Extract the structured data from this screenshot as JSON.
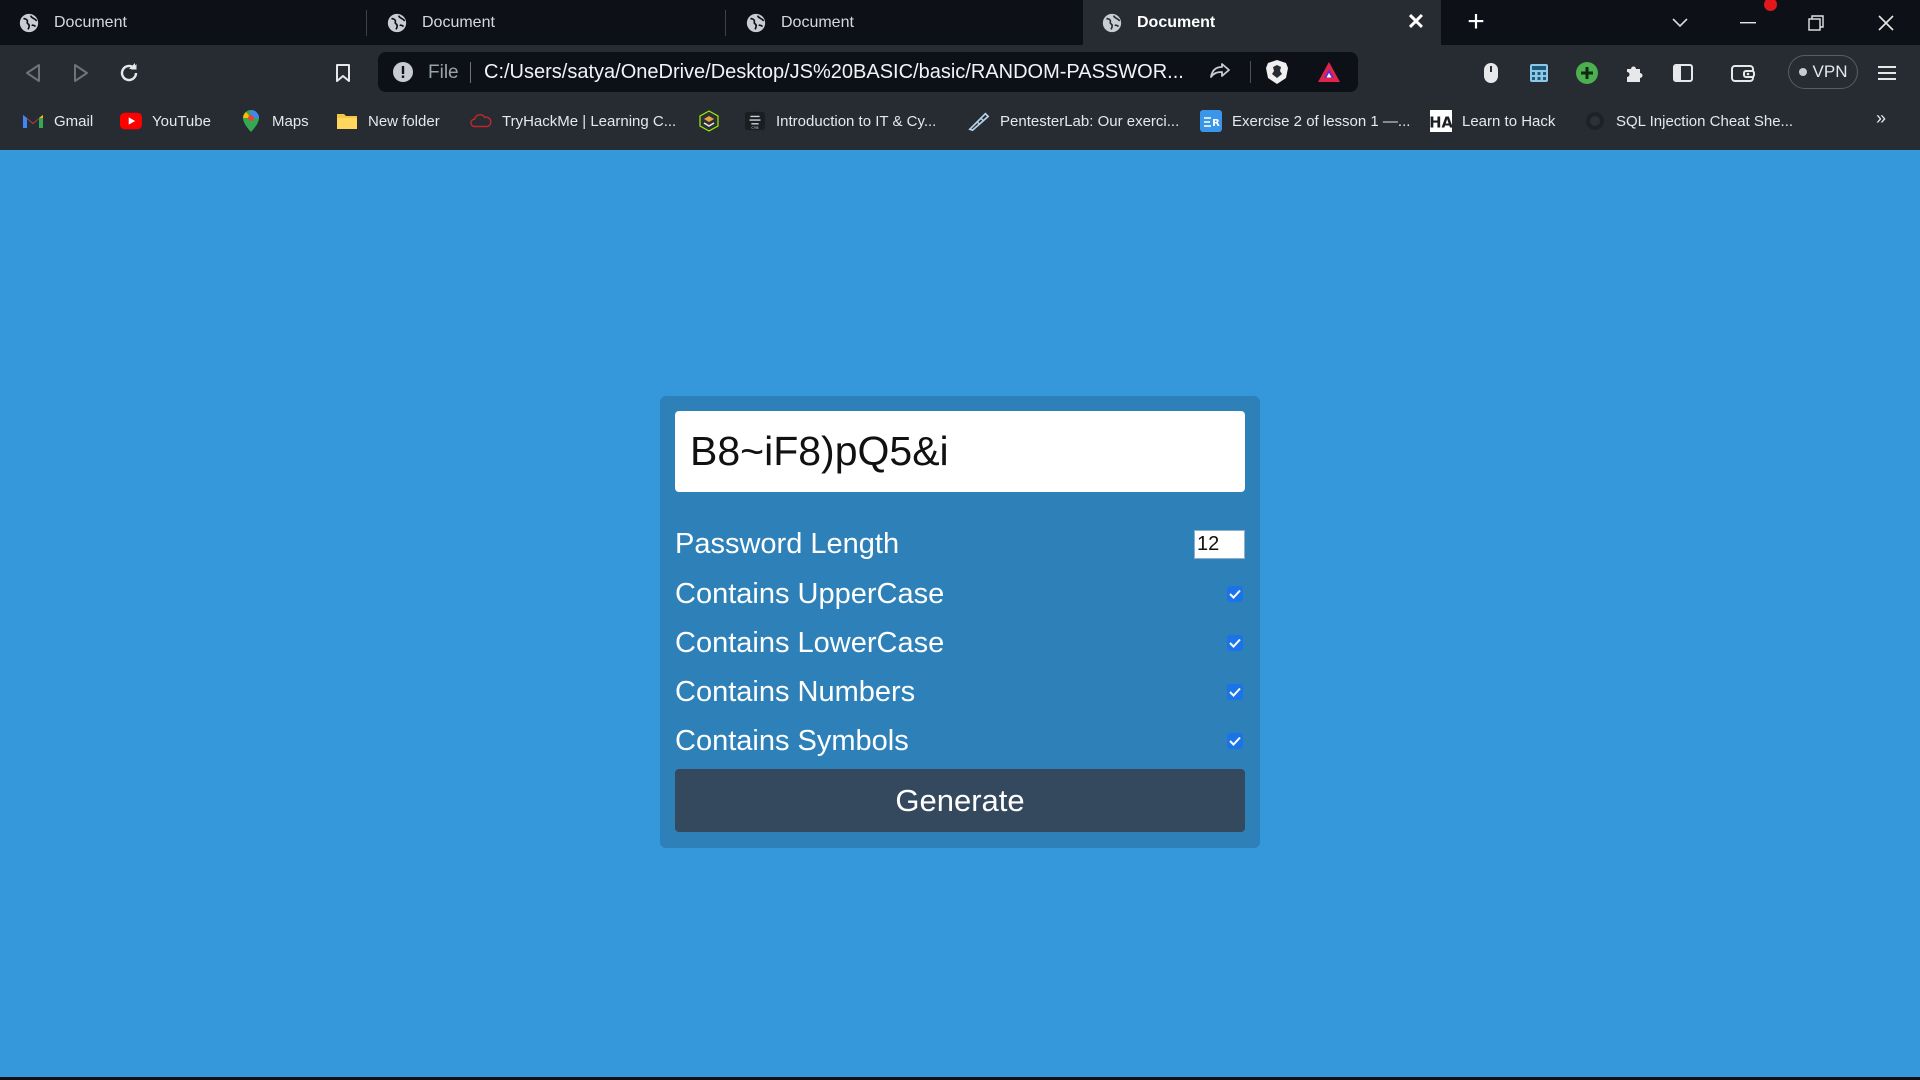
{
  "browser": {
    "tabs": [
      {
        "title": "Document",
        "active": false
      },
      {
        "title": "Document",
        "active": false
      },
      {
        "title": "Document",
        "active": false
      },
      {
        "title": "Document",
        "active": true
      }
    ],
    "address_bar": {
      "scheme_label": "File",
      "url": "C:/Users/satya/OneDrive/Desktop/JS%20BASIC/basic/RANDOM-PASSWOR..."
    },
    "vpn_label": "VPN",
    "bookmarks": [
      {
        "label": "Gmail",
        "icon": "gmail-icon"
      },
      {
        "label": "YouTube",
        "icon": "youtube-icon"
      },
      {
        "label": "Maps",
        "icon": "maps-icon"
      },
      {
        "label": "New folder",
        "icon": "folder-icon"
      },
      {
        "label": "TryHackMe | Learning C...",
        "icon": "tryhackme-icon"
      },
      {
        "label": "",
        "icon": "hackthebox-icon"
      },
      {
        "label": "Introduction to IT & Cy...",
        "icon": "course-icon"
      },
      {
        "label": "PentesterLab: Our exerci...",
        "icon": "pentesterlab-icon"
      },
      {
        "label": "Exercise 2 of lesson 1 —...",
        "icon": "exercise-icon"
      },
      {
        "label": "Learn to Hack",
        "icon": "hackeracademy-icon"
      },
      {
        "label": "SQL Injection Cheat She...",
        "icon": "sqli-icon"
      }
    ],
    "colors": {
      "tabstrip": "#0d1117",
      "toolbar": "#272c33"
    }
  },
  "app": {
    "password": "B8~iF8)pQ5&i",
    "length_label": "Password Length",
    "length_value": "12",
    "options": [
      {
        "label": "Contains UpperCase",
        "checked": true
      },
      {
        "label": "Contains LowerCase",
        "checked": true
      },
      {
        "label": "Contains Numbers",
        "checked": true
      },
      {
        "label": "Contains Symbols",
        "checked": true
      }
    ],
    "generate_label": "Generate",
    "colors": {
      "page_bg": "#3498db",
      "card_bg": "#2e80b9",
      "button_bg": "#34495e"
    }
  }
}
